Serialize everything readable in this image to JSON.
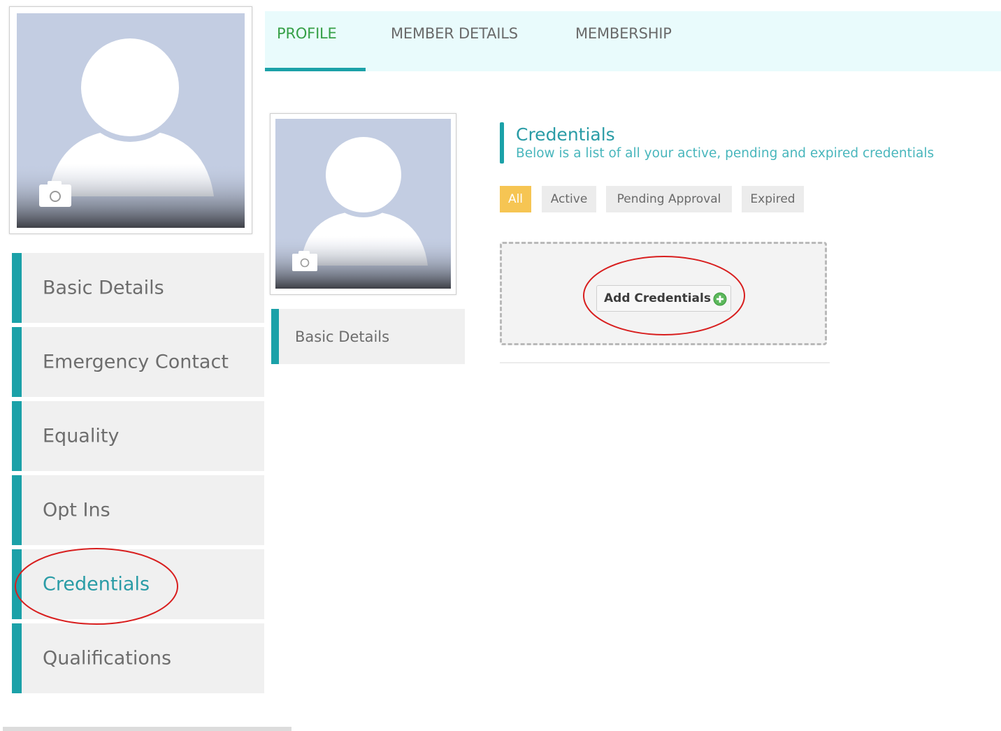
{
  "tabs": [
    {
      "label": "PROFILE",
      "active": true
    },
    {
      "label": "MEMBER DETAILS",
      "active": false
    },
    {
      "label": "MEMBERSHIP",
      "active": false
    }
  ],
  "left_nav": {
    "items": [
      {
        "label": "Basic Details",
        "active": false
      },
      {
        "label": "Emergency Contact",
        "active": false
      },
      {
        "label": "Equality",
        "active": false
      },
      {
        "label": "Opt Ins",
        "active": false
      },
      {
        "label": "Credentials",
        "active": true
      },
      {
        "label": "Qualifications",
        "active": false
      }
    ]
  },
  "inner_nav": {
    "label": "Basic Details"
  },
  "credentials": {
    "title": "Credentials",
    "subtitle": "Below is a list of all your active, pending and expired credentials",
    "filters": [
      {
        "label": "All",
        "active": true
      },
      {
        "label": "Active",
        "active": false
      },
      {
        "label": "Pending Approval",
        "active": false
      },
      {
        "label": "Expired",
        "active": false
      }
    ],
    "add_button": "Add Credentials"
  },
  "icons": {
    "avatar": "user-placeholder-icon",
    "camera": "camera-icon",
    "add": "plus-circle-icon"
  },
  "colors": {
    "accent_teal": "#1ba1a8",
    "active_tab": "#36a047",
    "active_filter": "#f6c553",
    "annotation": "#d81e1e"
  }
}
